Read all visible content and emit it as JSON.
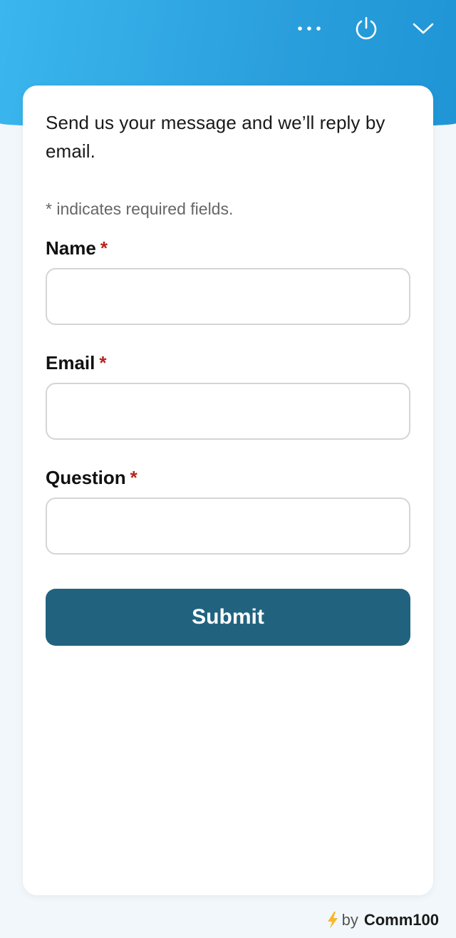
{
  "header": {
    "icons": [
      "more-dots-icon",
      "power-icon",
      "chevron-down-icon"
    ],
    "background_colors": [
      "#3bb6ee",
      "#1f95d6"
    ]
  },
  "form": {
    "intro": "Send us your message and we’ll reply by email.",
    "required_note": "* indicates required fields.",
    "fields": [
      {
        "label": "Name",
        "required_mark": "*",
        "value": ""
      },
      {
        "label": "Email",
        "required_mark": "*",
        "value": ""
      },
      {
        "label": "Question",
        "required_mark": "*",
        "value": ""
      }
    ],
    "submit_label": "Submit",
    "submit_color": "#21637f",
    "required_color": "#b3261e"
  },
  "footer": {
    "by_text": "by",
    "brand": "Comm100",
    "icon": "lightning-bolt-icon"
  }
}
